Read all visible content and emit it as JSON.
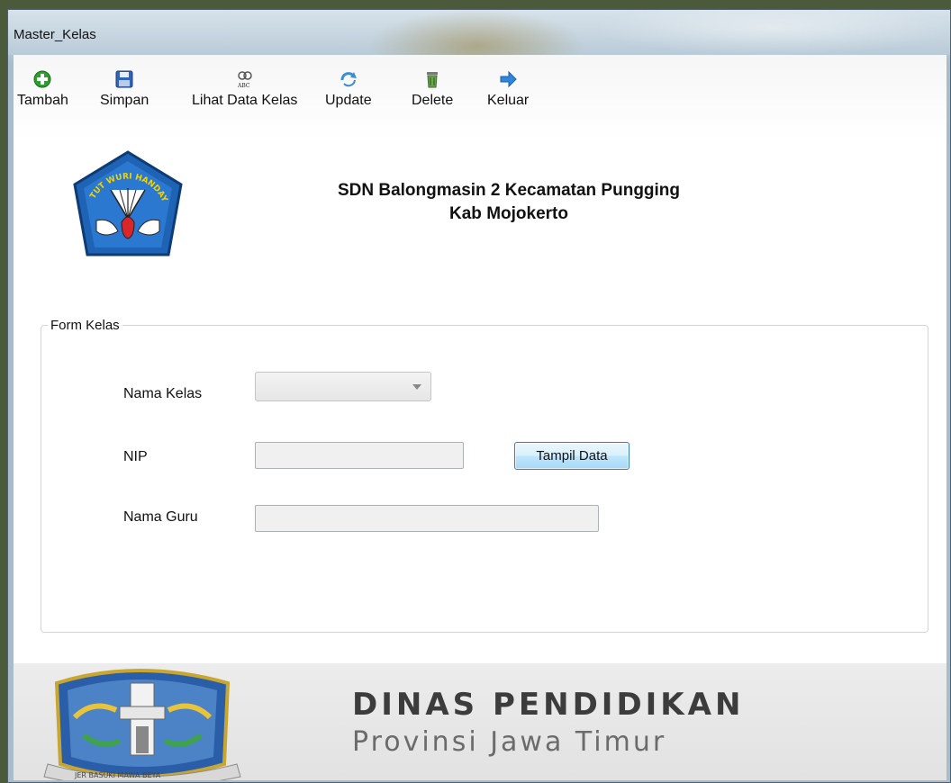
{
  "window": {
    "title": "Master_Kelas"
  },
  "toolbar": {
    "items": [
      {
        "label": "Tambah",
        "icon": "add-icon"
      },
      {
        "label": "Simpan",
        "icon": "save-icon"
      },
      {
        "label": "Lihat Data Kelas",
        "icon": "view-data-icon"
      },
      {
        "label": "Update",
        "icon": "update-icon"
      },
      {
        "label": "Delete",
        "icon": "delete-icon"
      },
      {
        "label": "Keluar",
        "icon": "exit-arrow-icon"
      }
    ]
  },
  "header": {
    "school_line1": "SDN Balongmasin 2 Kecamatan Pungging",
    "school_line2": "Kab Mojokerto",
    "logo_text": "TUT WURI HANDAYANI"
  },
  "form": {
    "legend": "Form Kelas",
    "nama_kelas_label": "Nama Kelas",
    "nama_kelas_value": "",
    "nip_label": "NIP",
    "nip_value": "",
    "tampil_button": "Tampil Data",
    "nama_guru_label": "Nama Guru",
    "nama_guru_value": ""
  },
  "footer": {
    "title": "DINAS PENDIDIKAN",
    "subtitle": "Provinsi Jawa Timur",
    "seal_text": "JER BASUKI MAWA BEYA"
  },
  "colors": {
    "accent_blue": "#1e5fa8",
    "button_border": "#3c7fb1",
    "footer_bg": "#e6e6e6"
  }
}
